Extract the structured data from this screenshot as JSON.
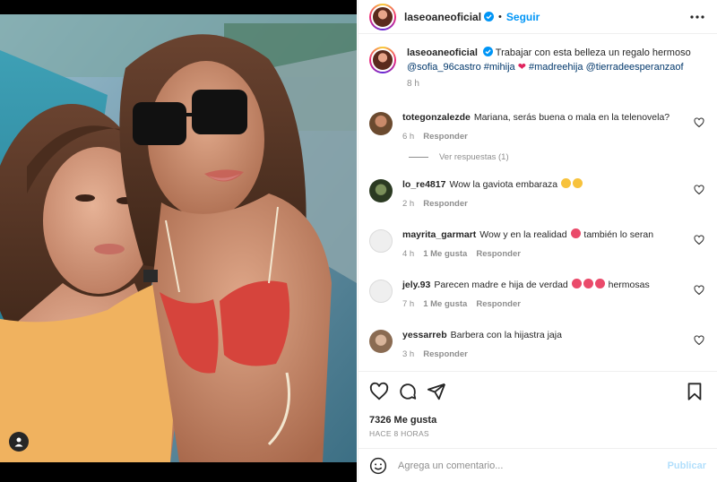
{
  "post": {
    "author": "laseoaneoficial",
    "follow_label": "Seguir",
    "separator": "•"
  },
  "caption": {
    "username": "laseoaneoficial",
    "text": "Trabajar con esta belleza un regalo hermoso",
    "mentions": [
      "@sofia_96castro",
      "#mihija",
      "#madreehija",
      "@tierradeesperanzaof"
    ],
    "time": "8 h"
  },
  "comments": [
    {
      "username": "totegonzalezde",
      "text": "Mariana, serás buena o mala en la telenovela?",
      "time": "6 h",
      "likes": "",
      "reply": "Responder",
      "view_replies": "Ver respuestas (1)"
    },
    {
      "username": "lo_re4817",
      "text": "Wow la gaviota embaraza",
      "time": "2 h",
      "likes": "",
      "reply": "Responder"
    },
    {
      "username": "mayrita_garmart",
      "text": "Wow y en la realidad",
      "text2": "también lo seran",
      "time": "4 h",
      "likes": "1 Me gusta",
      "reply": "Responder"
    },
    {
      "username": "jely.93",
      "text": "Parecen madre e hija de verdad",
      "text2": "hermosas",
      "time": "7 h",
      "likes": "1 Me gusta",
      "reply": "Responder"
    },
    {
      "username": "yessarreb",
      "text": "Barbera con la hijastra jaja",
      "time": "3 h",
      "likes": "",
      "reply": "Responder"
    }
  ],
  "actions": {
    "likes": "7326 Me gusta",
    "ago": "HACE 8 HORAS"
  },
  "composer": {
    "placeholder": "Agrega un comentario...",
    "publish_label": "Publicar"
  },
  "colors": {
    "accent": "#0095f6",
    "muted": "#8e8e8e",
    "link": "#00376b",
    "like_red": "#ed4956"
  },
  "icons": [
    "verified-icon",
    "more-icon",
    "heart-icon",
    "comment-icon",
    "share-icon",
    "bookmark-icon",
    "emoji-icon",
    "user-tag-icon"
  ]
}
